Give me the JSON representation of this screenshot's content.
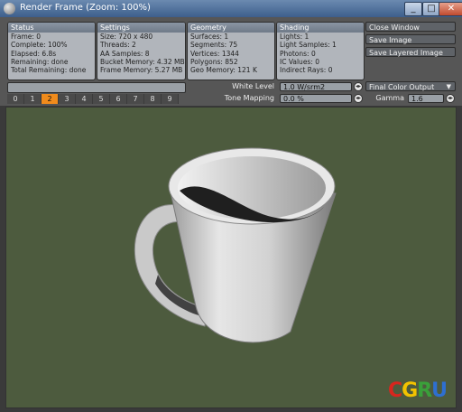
{
  "window": {
    "title": "Render Frame (Zoom: 100%)",
    "buttons": [
      "_",
      "□",
      "✕"
    ]
  },
  "stats": {
    "status": {
      "title": "Status",
      "lines": [
        "Frame: 0",
        "Complete: 100%",
        "Elapsed: 6.8s",
        "Remaining: done",
        "Total Remaining: done"
      ]
    },
    "settings": {
      "title": "Settings",
      "lines": [
        "Size: 720 x 480",
        "Threads: 2",
        "AA Samples: 8",
        "Bucket Memory: 4.32 MB",
        "Frame Memory: 5.27 MB"
      ]
    },
    "geometry": {
      "title": "Geometry",
      "lines": [
        "Surfaces: 1",
        "Segments: 75",
        "Vertices: 1344",
        "Polygons: 852",
        "Geo Memory: 121 K"
      ]
    },
    "shading": {
      "title": "Shading",
      "lines": [
        "Lights: 1",
        "Light Samples: 1",
        "Photons: 0",
        "IC Values: 0",
        "Indirect Rays: 0"
      ]
    }
  },
  "actions": {
    "close": "Close Window",
    "save": "Save Image",
    "save_layered": "Save Layered Image"
  },
  "frames": [
    "0",
    "1",
    "2",
    "3",
    "4",
    "5",
    "6",
    "7",
    "8",
    "9"
  ],
  "active_frame": 2,
  "controls": {
    "white_level_label": "White Level",
    "white_level_value": "1.0 W/srm2",
    "tone_mapping_label": "Tone Mapping",
    "tone_mapping_value": "0.0 %",
    "output_value": "Final Color Output",
    "gamma_label": "Gamma",
    "gamma_value": "1.6"
  },
  "watermark": {
    "text": "CGRU",
    "colors": {
      "C": "#d7261e",
      "G": "#f2c200",
      "R": "#3aa03a",
      "U": "#2e6fd0"
    }
  },
  "colors": {
    "accent": "#f08b1c",
    "viewport_bg": "#4d5b3e"
  }
}
